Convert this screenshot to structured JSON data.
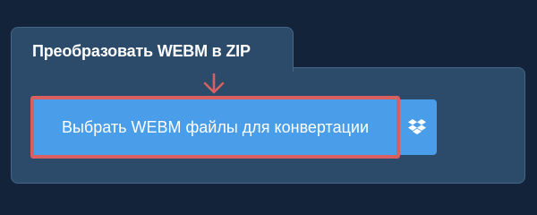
{
  "converter": {
    "tab_title": "Преобразовать WEBM в ZIP",
    "select_button_label": "Выбрать WEBM файлы для конвертации",
    "highlight_color": "#d96060",
    "button_color": "#4a9ee9",
    "arrow_icon": "arrow-down-icon",
    "dropbox_icon": "dropbox-icon"
  }
}
